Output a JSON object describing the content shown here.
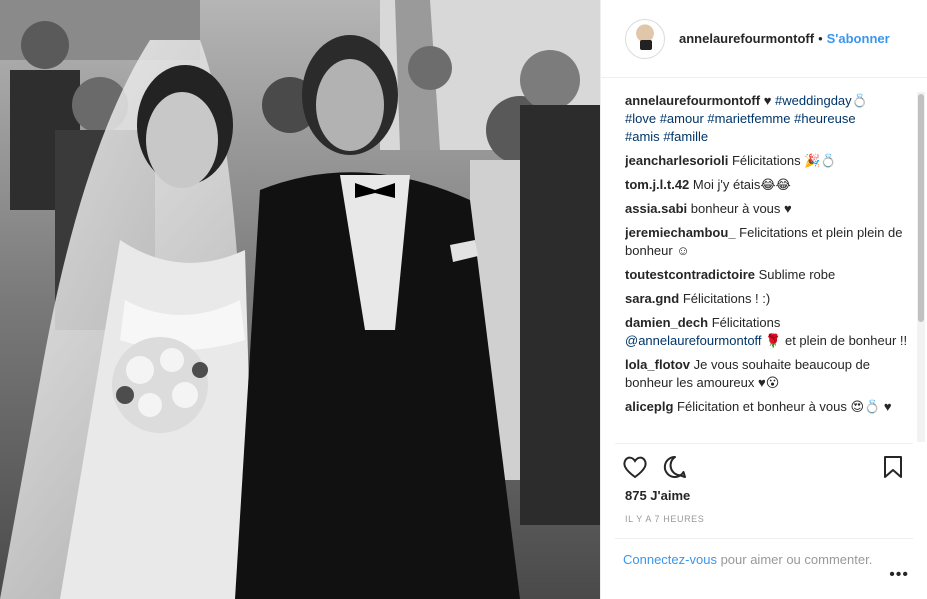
{
  "header": {
    "username": "annelaurefourmontoff",
    "separator": "•",
    "follow_label": "S'abonner"
  },
  "caption": {
    "username": "annelaurefourmontoff",
    "heart": "♥",
    "tags_line1": "#weddingday💍",
    "tags_line2": [
      "#love",
      "#amour",
      "#marietfemme",
      "#heureuse"
    ],
    "tags_line3": [
      "#amis",
      "#famille"
    ]
  },
  "comments": [
    {
      "user": "jeancharlesorioli",
      "text": "Félicitations 🎉💍"
    },
    {
      "user": "tom.j.l.t.42",
      "text": "Moi j'y étais😂😂"
    },
    {
      "user": "assia.sabi",
      "text": "bonheur à vous ♥"
    },
    {
      "user": "jeremiechambou_",
      "text": "Felicitations et plein plein de bonheur ☺"
    },
    {
      "user": "toutestcontradictoire",
      "text": "Sublime robe"
    },
    {
      "user": "sara.gnd",
      "text": "Félicitations ! :)"
    },
    {
      "user": "damien_dech",
      "text_before": "Félicitations",
      "mention": "@annelaurefourmontoff",
      "text_after": "🌹 et plein de bonheur !!"
    },
    {
      "user": "lola_flotov",
      "text": "Je vous souhaite beaucoup de bonheur les amoureux ♥😮"
    },
    {
      "user": "aliceplg",
      "text": "Félicitation et bonheur à vous 😍💍 ♥"
    }
  ],
  "likes": "875 J'aime",
  "timestamp": "IL Y A 7 HEURES",
  "login_prompt": {
    "link": "Connectez-vous",
    "text": " pour aimer ou commenter."
  },
  "more_label": "•••",
  "icons": {
    "like": "heart-icon",
    "comment": "comment-icon",
    "save": "bookmark-icon"
  },
  "colors": {
    "link": "#3897f0",
    "hashtag": "#003569",
    "muted": "#999999"
  }
}
